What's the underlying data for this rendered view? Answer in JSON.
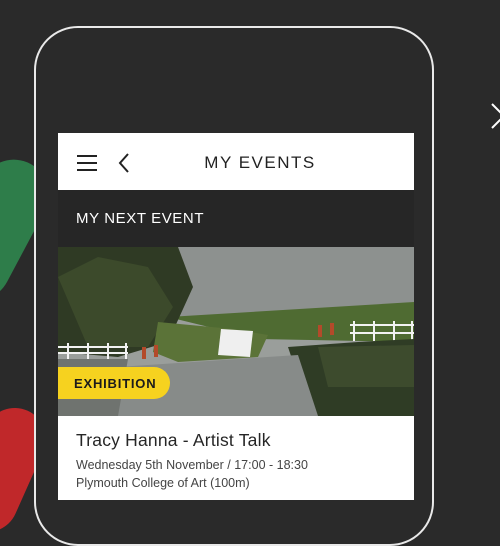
{
  "header": {
    "title": "MY EVENTS",
    "menu_icon": "hamburger-menu-icon",
    "back_icon": "chevron-left-icon"
  },
  "section": {
    "title": "MY NEXT EVENT"
  },
  "event": {
    "category": "EXHIBITION",
    "title": "Tracy Hanna - Artist Talk",
    "date": "Wednesday 5th November",
    "separator": "/",
    "time": "17:00 - 18:30",
    "location": "Plymouth College of Art (100m)"
  },
  "overlay": {
    "close_icon": "close-icon"
  },
  "colors": {
    "background": "#2a2a2a",
    "badge": "#f6d21f",
    "section_bar": "#262626",
    "accent_green": "#2e7d4a",
    "accent_yellow": "#e3a51f",
    "accent_red": "#c0282a"
  }
}
